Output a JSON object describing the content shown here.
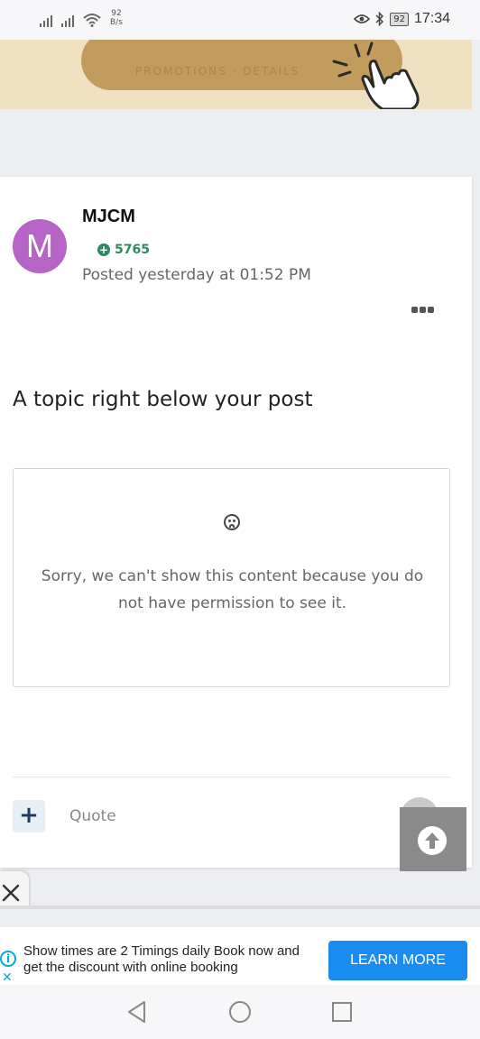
{
  "status_bar": {
    "net_speed_value": "92",
    "net_speed_unit": "B/s",
    "battery": "92",
    "time": "17:34"
  },
  "banner": {
    "text": "PROMOTIONS · DETAILS"
  },
  "post": {
    "avatar_letter": "M",
    "author": "MJCM",
    "reputation": "5765",
    "posted": "Posted yesterday at 01:52 PM",
    "body": "A topic right below your post",
    "embed_message": "Sorry, we can't show this content because you do not have permission to see it.",
    "quote_label": "Quote",
    "add_label": "+"
  },
  "ad": {
    "text": "Show times are 2 Timings daily Book now and get the discount with online booking",
    "button": "LEARN MORE",
    "info": "i",
    "close": "✕"
  },
  "colors": {
    "avatar": "#b665c7",
    "reputation": "#2f8a5f",
    "ad_button": "#1a8cf0"
  }
}
